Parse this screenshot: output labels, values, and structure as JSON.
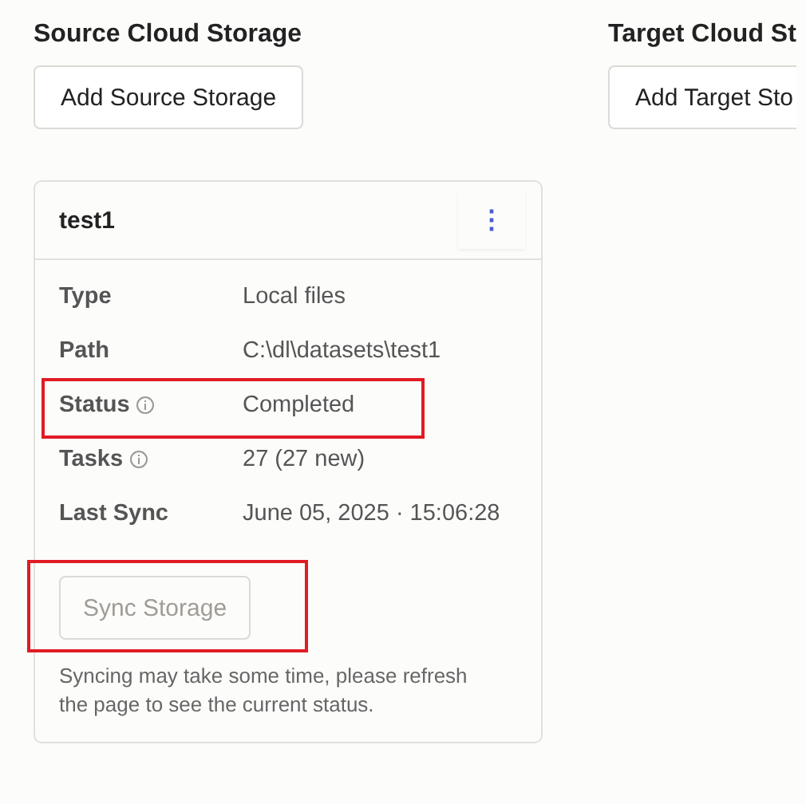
{
  "columns": [
    {
      "title": "Source Cloud Storage",
      "add_button": "Add Source Storage",
      "cards": [
        {
          "name": "test1",
          "menu": "⋮",
          "details": [
            {
              "label": "Type",
              "value": "Local files",
              "info": false,
              "highlighted": false
            },
            {
              "label": "Path",
              "value": "C:\\dl\\datasets\\test1",
              "info": false,
              "highlighted": false
            },
            {
              "label": "Status",
              "value": "Completed",
              "info": true,
              "highlighted": true
            },
            {
              "label": "Tasks",
              "value": "27 (27 new)",
              "info": true,
              "highlighted": false
            },
            {
              "label": "Last Sync",
              "value": "June 05, 2025 · 15:06:28",
              "info": false,
              "highlighted": false
            }
          ],
          "sync_button": {
            "label": "Sync Storage",
            "disabled": true,
            "highlighted": true
          },
          "note": "Syncing may take some time, please refresh the page to see the current status."
        }
      ]
    },
    {
      "title": "Target Cloud St",
      "add_button": "Add Target Sto"
    }
  ]
}
